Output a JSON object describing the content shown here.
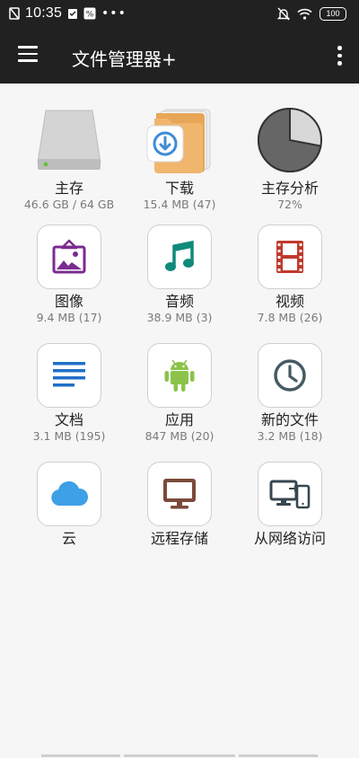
{
  "status": {
    "time": "10:35",
    "battery": "100"
  },
  "appbar": {
    "title": "文件管理器+"
  },
  "tiles": [
    {
      "label": "主存",
      "sub": "46.6 GB / 64 GB"
    },
    {
      "label": "下载",
      "sub": "15.4 MB (47)"
    },
    {
      "label": "主存分析",
      "sub": "72%"
    },
    {
      "label": "图像",
      "sub": "9.4 MB (17)"
    },
    {
      "label": "音频",
      "sub": "38.9 MB (3)"
    },
    {
      "label": "视频",
      "sub": "7.8 MB (26)"
    },
    {
      "label": "文档",
      "sub": "3.1 MB (195)"
    },
    {
      "label": "应用",
      "sub": "847 MB (20)"
    },
    {
      "label": "新的文件",
      "sub": "3.2 MB (18)"
    },
    {
      "label": "云",
      "sub": ""
    },
    {
      "label": "远程存储",
      "sub": ""
    },
    {
      "label": "从网络访问",
      "sub": ""
    }
  ],
  "storage_usage_fraction": 0.72,
  "colors": {
    "appbar": "#212121",
    "image": "#7b2b8f",
    "audio": "#0f8a7a",
    "video": "#c0392b",
    "docs": "#1f6fc7",
    "apps": "#8bc34a",
    "clock": "#455a64",
    "cloud": "#3ea0e6",
    "remote": "#7b4a3a",
    "network": "#37474f"
  }
}
